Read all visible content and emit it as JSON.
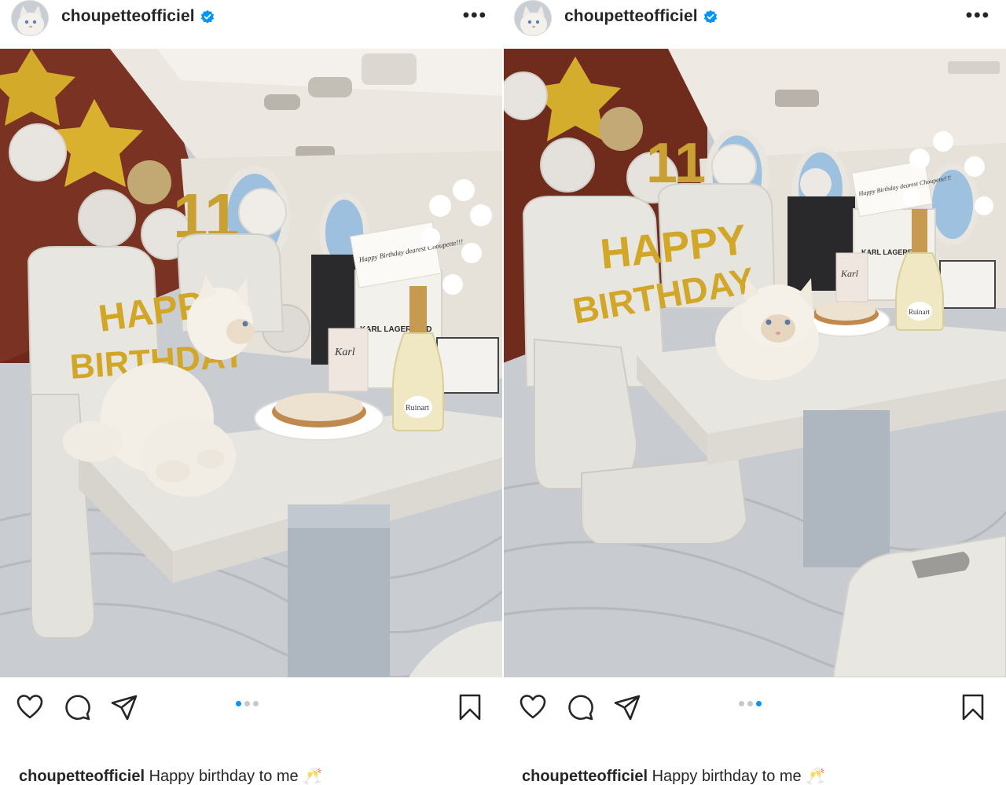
{
  "posts": [
    {
      "username": "choupetteofficiel",
      "caption_user": "choupetteofficiel",
      "caption_text": "Happy birthday to me 🥂",
      "carousel": {
        "count": 3,
        "active": 1
      },
      "image": {
        "balloon_text_top": "HAPPY",
        "balloon_text_bottom": "BIRTHDAY",
        "balloon_number": "11",
        "bag_label": "KARL LAGERFELD",
        "box_label": "Karl",
        "bottle_label": "Ruinart",
        "card_text": "Happy Birthday dearest Choupette!!!"
      }
    },
    {
      "username": "choupetteofficiel",
      "caption_user": "choupetteofficiel",
      "caption_text": "Happy birthday to me 🥂",
      "carousel": {
        "count": 3,
        "active": 3
      },
      "image": {
        "balloon_text_top": "HAPPY",
        "balloon_text_bottom": "BIRTHDAY",
        "balloon_number": "11",
        "bag_label": "KARL LAGERFELD",
        "box_label": "Karl",
        "bottle_label": "Ruinart",
        "card_text": "Happy Birthday dearest Choupette!!!"
      }
    }
  ],
  "icons": {
    "more": "more-options-icon",
    "verified": "verified-badge-icon",
    "like": "heart-icon",
    "comment": "comment-icon",
    "share": "paper-plane-icon",
    "save": "bookmark-icon"
  },
  "colors": {
    "verified_blue": "#0095f6",
    "active_dot": "#0095f6",
    "inactive_dot": "#c7c7c7",
    "text": "#262626"
  }
}
